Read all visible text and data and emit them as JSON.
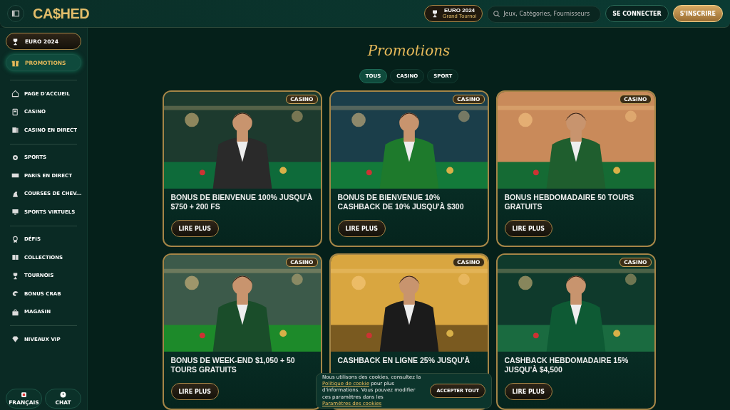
{
  "header": {
    "logo": "CA$HED",
    "event_button": {
      "title": "EURO 2024",
      "subtitle": "Grand Tournoi"
    },
    "search": {
      "placeholder": "Jeux, Catégories, Fournisseurs"
    },
    "login_button": "SE CONNECTER",
    "signup_button": "S'INSCRIRE"
  },
  "sidebar": {
    "featured": [
      {
        "label": "EURO 2024",
        "selected": false
      },
      {
        "label": "PROMOTIONS",
        "selected": true
      }
    ],
    "groups": [
      {
        "items": [
          "PAGE D'ACCUEIL",
          "CASINO",
          "CASINO EN DIRECT"
        ]
      },
      {
        "items": [
          "SPORTS",
          "PARIS EN DIRECT",
          "COURSES DE CHEV...",
          "SPORTS VIRTUELS"
        ]
      },
      {
        "items": [
          "DÉFIS",
          "COLLECTIONS",
          "TOURNOIS",
          "BONUS CRAB",
          "MAGASIN"
        ]
      },
      {
        "items": [
          "NIVEAUX VIP"
        ]
      }
    ],
    "footer": {
      "language": "FRANÇAIS",
      "chat": "CHAT"
    }
  },
  "page_title": "Promotions",
  "filter_tabs": [
    {
      "label": "TOUS",
      "selected": true
    },
    {
      "label": "CASINO",
      "selected": false
    },
    {
      "label": "SPORT",
      "selected": false
    }
  ],
  "promotions": [
    {
      "badge": "CASINO",
      "title": "BONUS DE BIENVENUE 100% JUSQU'À $750 + 200 FS",
      "button": "LIRE PLUS"
    },
    {
      "badge": "CASINO",
      "title": "BONUS DE BIENVENUE 10% CASHBACK DE 10% JUSQU'À $300",
      "button": "LIRE PLUS"
    },
    {
      "badge": "CASINO",
      "title": "BONUS HEBDOMADAIRE 50 TOURS GRATUITS",
      "button": "LIRE PLUS"
    },
    {
      "badge": "CASINO",
      "title": "BONUS DE WEEK-END $1,050 + 50 TOURS GRATUITS",
      "button": "LIRE PLUS"
    },
    {
      "badge": "CASINO",
      "title": "CASHBACK EN LIGNE 25% JUSQU'À"
    },
    {
      "badge": "CASINO",
      "title": "CASHBACK HEBDOMADAIRE 15% JUSQU'À $4,500",
      "button": "LIRE PLUS"
    }
  ],
  "cookie_banner": {
    "text_before": "Nous utilisons des cookies, consultez la",
    "policy_link": "Politique de cookie",
    "text_middle": "pour plus d'informations. Vous pouvez modifier ces paramètres dans les",
    "settings_link": "Paramètres des cookies",
    "accept_button": "ACCEPTER TOUT"
  }
}
